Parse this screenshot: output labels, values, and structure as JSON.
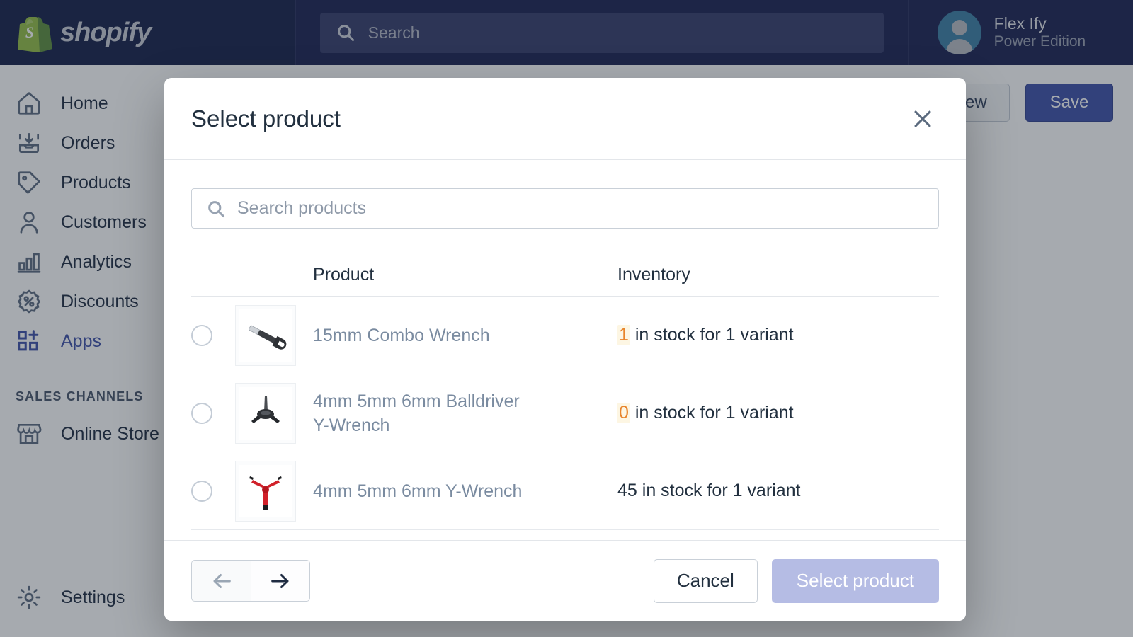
{
  "topbar": {
    "brand": "shopify",
    "search_placeholder": "Search",
    "user_name": "Flex Ify",
    "user_plan": "Power Edition"
  },
  "sidebar": {
    "items": [
      {
        "label": "Home",
        "icon": "home-icon",
        "active": false
      },
      {
        "label": "Orders",
        "icon": "orders-icon",
        "active": false
      },
      {
        "label": "Products",
        "icon": "products-icon",
        "active": false
      },
      {
        "label": "Customers",
        "icon": "customers-icon",
        "active": false
      },
      {
        "label": "Analytics",
        "icon": "analytics-icon",
        "active": false
      },
      {
        "label": "Discounts",
        "icon": "discounts-icon",
        "active": false
      },
      {
        "label": "Apps",
        "icon": "apps-icon",
        "active": true
      }
    ],
    "section_label": "SALES CHANNELS",
    "channels": [
      {
        "label": "Online Store",
        "icon": "store-icon"
      }
    ],
    "bottom": {
      "label": "Settings",
      "icon": "gear-icon"
    }
  },
  "page_actions": {
    "preview_label": "Preview",
    "save_label": "Save"
  },
  "modal": {
    "title": "Select product",
    "close_icon": "close-icon",
    "search_placeholder": "Search products",
    "columns": {
      "product": "Product",
      "inventory": "Inventory"
    },
    "rows": [
      {
        "name": "15mm Combo Wrench",
        "thumb": "combo-wrench-image",
        "inventory_count": "1",
        "inventory_text": "in stock for 1 variant",
        "inventory_highlighted": true
      },
      {
        "name": "4mm 5mm 6mm Balldriver Y-Wrench",
        "thumb": "balldriver-y-wrench-image",
        "inventory_count": "0",
        "inventory_text": "in stock for 1 variant",
        "inventory_highlighted": true
      },
      {
        "name": "4mm 5mm 6mm Y-Wrench",
        "thumb": "y-wrench-image",
        "inventory_count": "45",
        "inventory_text": "in stock for 1 variant",
        "inventory_highlighted": false
      }
    ],
    "footer": {
      "prev_icon": "arrow-left-icon",
      "next_icon": "arrow-right-icon",
      "cancel_label": "Cancel",
      "submit_label": "Select product"
    }
  },
  "colors": {
    "topbar_bg": "#1c2252",
    "accent_blue": "#3f51a8",
    "inventory_warning": "#e8842a",
    "primary_disabled": "#b5bce4"
  }
}
